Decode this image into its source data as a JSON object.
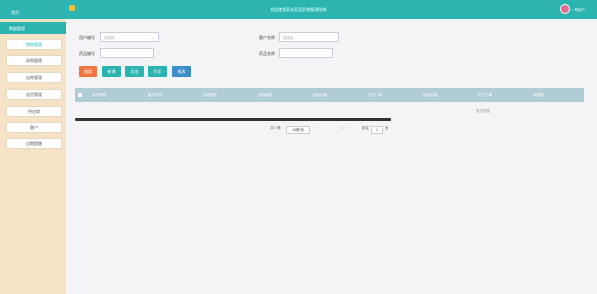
{
  "header": {
    "title": "欢迎使用药店药品药物管理系统",
    "user_label": "一号用户"
  },
  "sidebar": {
    "home": "首页",
    "group": "数据管理",
    "items": [
      {
        "label": "销售管理"
      },
      {
        "label": "采购管理"
      },
      {
        "label": "出库管理"
      },
      {
        "label": "退货管理"
      },
      {
        "label": "供应商"
      },
      {
        "label": "客户"
      },
      {
        "label": "过期提醒"
      }
    ]
  },
  "filters": {
    "user_id_label": "用户编号",
    "user_id_placeholder": "请选择",
    "customer_name_label": "客户名称",
    "customer_name_placeholder": "请选择",
    "drug_code_label": "药品编号",
    "drug_name_label": "药品名称"
  },
  "actions": {
    "search": "搜索",
    "add": "新增",
    "export": "导出",
    "print": "打印",
    "report": "报表"
  },
  "actions_colors": {
    "search": "#f07840",
    "add": "#2cb5b0",
    "export": "#2cb5b0",
    "print": "#2cb5b0",
    "report": "#3a8fc7"
  },
  "table": {
    "columns": [
      "用户编号",
      "客户名称",
      "药品类型",
      "药品编号",
      "药品名称",
      "生产厂商",
      "药品价格",
      "生产日期",
      "保质期"
    ],
    "empty_text": "暂无数据"
  },
  "pagination": {
    "total": "共 0 条",
    "page_size": "10条/页",
    "prev": "‹",
    "current_page": "1",
    "next": "›",
    "goto_label": "前往",
    "goto_value": "1",
    "page_suffix": "页"
  }
}
